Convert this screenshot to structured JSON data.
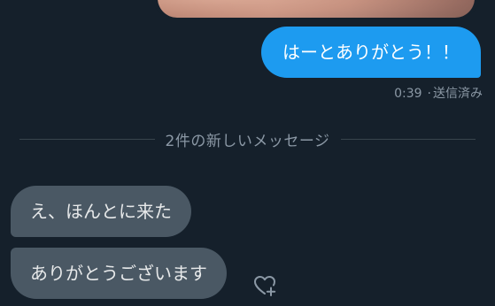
{
  "conversation": {
    "outgoing": [
      {
        "text": "はーとありがとう！！",
        "time": "0:39",
        "separator": "·",
        "status": "送信済み"
      }
    ],
    "new_messages_divider": "2件の新しいメッセージ",
    "incoming": [
      {
        "text": "え、ほんとに来た"
      },
      {
        "text": "ありがとうございます"
      }
    ]
  },
  "colors": {
    "background": "#15202b",
    "outgoing_bubble": "#1d9bf0",
    "incoming_bubble": "#4a5864",
    "muted_text": "#8b98a5"
  },
  "icons": {
    "react": "heart-plus-icon"
  }
}
